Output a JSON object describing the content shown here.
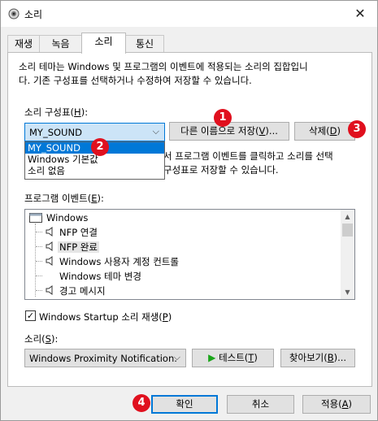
{
  "window": {
    "title": "소리",
    "close_glyph": "✕"
  },
  "tabs": [
    {
      "label": "재생"
    },
    {
      "label": "녹음"
    },
    {
      "label": "소리"
    },
    {
      "label": "통신"
    }
  ],
  "description_line1": "소리 테마는 Windows 및 프로그램의 이벤트에 적용되는 소리의 집합입니",
  "description_line2": "다. 기존 구성표를 선택하거나 수정하여 저장할 수 있습니다.",
  "scheme": {
    "label_prefix": "소리 구성표(",
    "label_key": "H",
    "label_suffix": "):",
    "selected": "MY_SOUND",
    "save_button_prefix": "다른 이름으로 저장(",
    "save_button_key": "V",
    "save_button_suffix": ")...",
    "delete_button_prefix": "삭제(",
    "delete_button_key": "D",
    "delete_button_suffix": ")",
    "options": [
      "MY_SOUND",
      "Windows 기본값",
      "소리 없음"
    ]
  },
  "hidden_desc_line1": "서 프로그램 이벤트를 클릭하고 소리를 선택",
  "hidden_desc_line2": "구성표로 저장할 수 있습니다.",
  "events": {
    "label_prefix": "프로그램 이벤트(",
    "label_key": "E",
    "label_suffix": "):",
    "group": "Windows",
    "items": [
      "NFP 연결",
      "NFP 완료",
      "Windows 사용자 계정 컨트롤",
      "Windows 테마 변경",
      "경고 메시지"
    ]
  },
  "startup": {
    "checked": true,
    "label_prefix": "Windows Startup 소리 재생(",
    "label_key": "P",
    "label_suffix": ")"
  },
  "sound": {
    "label_prefix": "소리(",
    "label_key": "S",
    "label_suffix": "):",
    "selected": "Windows Proximity Notification.",
    "test_prefix": "테스트(",
    "test_key": "T",
    "test_suffix": ")",
    "browse_prefix": "찾아보기(",
    "browse_key": "B",
    "browse_suffix": ")..."
  },
  "footer": {
    "ok": "확인",
    "cancel": "취소",
    "apply_prefix": "적용(",
    "apply_key": "A",
    "apply_suffix": ")"
  },
  "badges": [
    "1",
    "2",
    "3",
    "4"
  ],
  "colors": {
    "badge": "#e0101e",
    "selection": "#0078d7",
    "test_arrow": "#1aa51a"
  }
}
